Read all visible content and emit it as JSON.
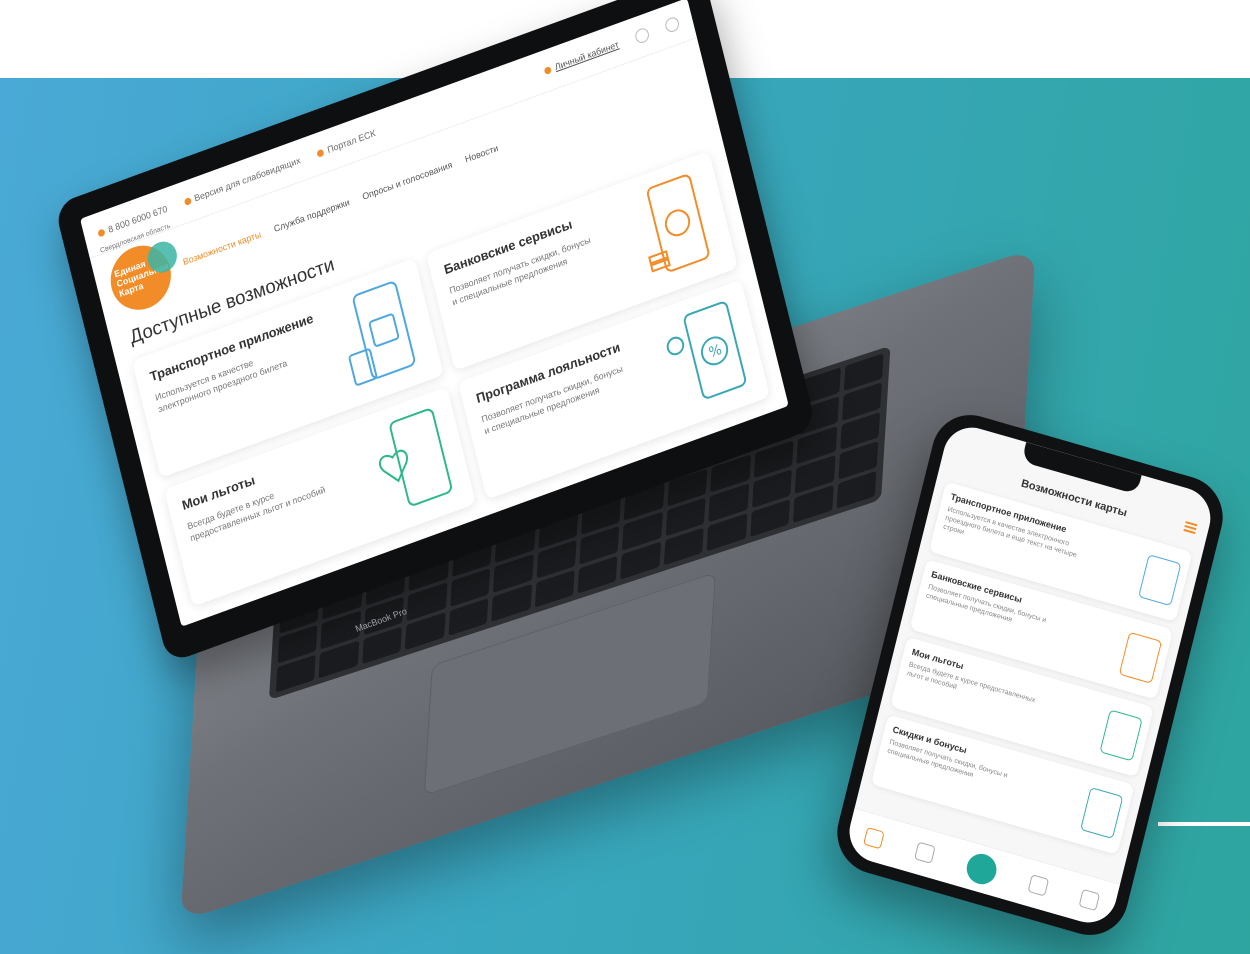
{
  "laptop": {
    "topbar": {
      "phone": "8 800 6000 670",
      "for_partners": "Версия для слабовидящих",
      "portal": "Портал ЕСК",
      "account": "Личный кабинет"
    },
    "logo": {
      "region": "Свердловская область",
      "line1": "Единая",
      "line2": "Социальная",
      "line3": "Карта"
    },
    "nav": {
      "item_active": "Возможности карты",
      "item_support": "Служба поддержки",
      "item_polls": "Опросы и голосования",
      "item_news": "Новости"
    },
    "page_title": "Доступные возможности",
    "cards": [
      {
        "title": "Транспортное приложение",
        "text": "Используется в качестве электронного проездного билета"
      },
      {
        "title": "Банковские сервисы",
        "text": "Позволяет получать скидки, бонусы и специальные предложения"
      },
      {
        "title": "Мои льготы",
        "text": "Всегда будете в курсе предоставленных льгот и пособий"
      },
      {
        "title": "Программа лояльности",
        "text": "Позволяет получать скидки, бонусы и специальные предложения"
      }
    ],
    "device_label": "MacBook Pro"
  },
  "phone": {
    "header_title": "Возможности карты",
    "cards": [
      {
        "title": "Транспортное приложение",
        "text": "Используется в качестве электронного проездного билета и ещё текст на четыре строки"
      },
      {
        "title": "Банковские сервисы",
        "text": "Позволяет получать скидки, бонусы и специальные предложения"
      },
      {
        "title": "Мои льготы",
        "text": "Всегда будете в курсе предоставленных льгот и пособий"
      },
      {
        "title": "Скидки и бонусы",
        "text": "Позволяет получать скидки, бонусы и специальные предложения"
      }
    ]
  },
  "colors": {
    "accent": "#f28c28",
    "teal": "#1fa89a",
    "background_start": "#4aa9d6",
    "background_end": "#2ea59f"
  }
}
